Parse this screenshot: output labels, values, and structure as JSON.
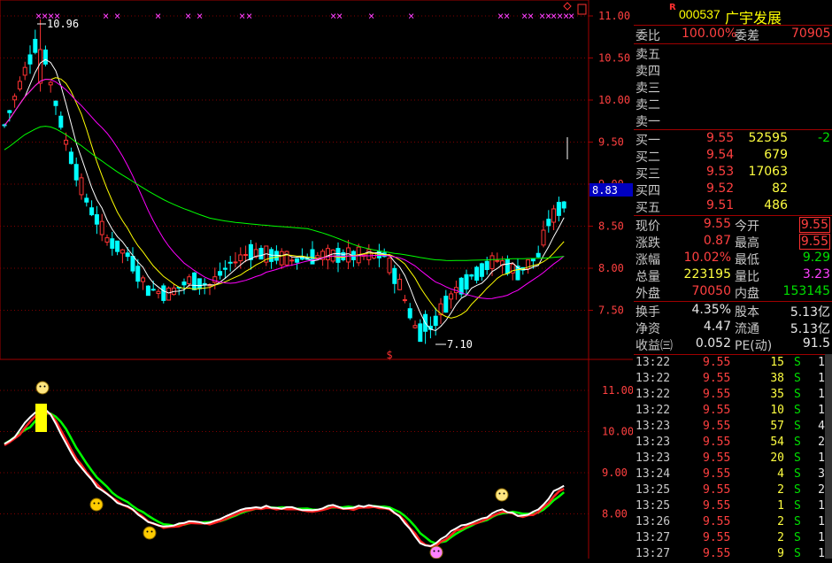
{
  "chart": {
    "price_axis_labels": [
      "11.00",
      "10.50",
      "10.00",
      "9.50",
      "9.00",
      "8.50",
      "8.00",
      "7.50"
    ],
    "current_price_tag": "8.83",
    "high_label": "10.96",
    "low_label": "7.10",
    "signal_marker": "$",
    "indicator_axis_labels": [
      "11.00",
      "10.00",
      "9.00",
      "8.00"
    ],
    "colors": {
      "up": "#ff3333",
      "down": "#00ffff",
      "ma5": "#ffffff",
      "ma10": "#ffff00",
      "ma20": "#ff00ff",
      "ma60": "#00ff00",
      "grid": "#800000"
    }
  },
  "stock": {
    "r_mark": "R",
    "code": "000537",
    "name": "广宇发展"
  },
  "weibi": {
    "label1": "委比",
    "val1": "100.00%",
    "label2": "委差",
    "val2": "70905"
  },
  "asks": [
    {
      "label": "卖五",
      "price": "",
      "vol": ""
    },
    {
      "label": "卖四",
      "price": "",
      "vol": ""
    },
    {
      "label": "卖三",
      "price": "",
      "vol": ""
    },
    {
      "label": "卖二",
      "price": "",
      "vol": ""
    },
    {
      "label": "卖一",
      "price": "",
      "vol": ""
    }
  ],
  "bids": [
    {
      "label": "买一",
      "price": "9.55",
      "vol": "52595",
      "chg": "-2"
    },
    {
      "label": "买二",
      "price": "9.54",
      "vol": "679",
      "chg": ""
    },
    {
      "label": "买三",
      "price": "9.53",
      "vol": "17063",
      "chg": ""
    },
    {
      "label": "买四",
      "price": "9.52",
      "vol": "82",
      "chg": ""
    },
    {
      "label": "买五",
      "price": "9.51",
      "vol": "486",
      "chg": ""
    }
  ],
  "quote": [
    {
      "l1": "现价",
      "v1": "9.55",
      "l2": "今开",
      "v2": "9.55"
    },
    {
      "l1": "涨跌",
      "v1": "0.87",
      "l2": "最高",
      "v2": "9.55"
    },
    {
      "l1": "涨幅",
      "v1": "10.02%",
      "l2": "最低",
      "v2": "9.29"
    },
    {
      "l1": "总量",
      "v1": "223195",
      "l2": "量比",
      "v2": "3.23"
    },
    {
      "l1": "外盘",
      "v1": "70050",
      "l2": "内盘",
      "v2": "153145"
    }
  ],
  "fundamentals": [
    {
      "l1": "换手",
      "v1": "4.35%",
      "l2": "股本",
      "v2": "5.13亿"
    },
    {
      "l1": "净资",
      "v1": "4.47",
      "l2": "流通",
      "v2": "5.13亿"
    },
    {
      "l1": "收益㈢",
      "v1": "0.052",
      "l2": "PE(动)",
      "v2": "91.5"
    }
  ],
  "ticks": [
    {
      "time": "13:22",
      "price": "9.55",
      "vol": "15",
      "side": "S",
      "n": "1"
    },
    {
      "time": "13:22",
      "price": "9.55",
      "vol": "38",
      "side": "S",
      "n": "1"
    },
    {
      "time": "13:22",
      "price": "9.55",
      "vol": "35",
      "side": "S",
      "n": "1"
    },
    {
      "time": "13:22",
      "price": "9.55",
      "vol": "10",
      "side": "S",
      "n": "1"
    },
    {
      "time": "13:23",
      "price": "9.55",
      "vol": "57",
      "side": "S",
      "n": "4"
    },
    {
      "time": "13:23",
      "price": "9.55",
      "vol": "54",
      "side": "S",
      "n": "2"
    },
    {
      "time": "13:23",
      "price": "9.55",
      "vol": "20",
      "side": "S",
      "n": "1"
    },
    {
      "time": "13:24",
      "price": "9.55",
      "vol": "4",
      "side": "S",
      "n": "3"
    },
    {
      "time": "13:25",
      "price": "9.55",
      "vol": "2",
      "side": "S",
      "n": "2"
    },
    {
      "time": "13:25",
      "price": "9.55",
      "vol": "1",
      "side": "S",
      "n": "1"
    },
    {
      "time": "13:26",
      "price": "9.55",
      "vol": "2",
      "side": "S",
      "n": "1"
    },
    {
      "time": "13:27",
      "price": "9.55",
      "vol": "2",
      "side": "S",
      "n": "1"
    },
    {
      "time": "13:27",
      "price": "9.55",
      "vol": "9",
      "side": "S",
      "n": "1"
    }
  ]
}
